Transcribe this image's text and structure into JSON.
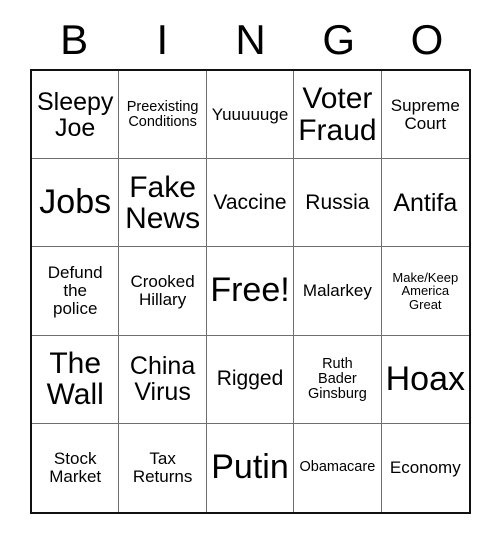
{
  "card": {
    "title": "BINGO Card",
    "header_letters": [
      "B",
      "I",
      "N",
      "G",
      "O"
    ],
    "free_space_label": "Free!",
    "colors": {
      "background": "#ffffff",
      "text": "#000000",
      "outer_border": "#111111",
      "inner_border": "#6e6e6e"
    },
    "grid": {
      "rows": 5,
      "columns": 5,
      "cells": [
        {
          "text": "Sleepy\nJoe",
          "size": "lg",
          "free": false
        },
        {
          "text": "Preexisting\nConditions",
          "size": "xs",
          "free": false
        },
        {
          "text": "Yuuuuuge",
          "size": "sm",
          "free": false
        },
        {
          "text": "Voter\nFraud",
          "size": "xl",
          "free": false
        },
        {
          "text": "Supreme\nCourt",
          "size": "sm",
          "free": false
        },
        {
          "text": "Jobs",
          "size": "xxl",
          "free": false
        },
        {
          "text": "Fake\nNews",
          "size": "xl",
          "free": false
        },
        {
          "text": "Vaccine",
          "size": "md",
          "free": false
        },
        {
          "text": "Russia",
          "size": "md",
          "free": false
        },
        {
          "text": "Antifa",
          "size": "lg",
          "free": false
        },
        {
          "text": "Defund\nthe\npolice",
          "size": "sm",
          "free": false
        },
        {
          "text": "Crooked\nHillary",
          "size": "sm",
          "free": false
        },
        {
          "text": "Free!",
          "size": "xxl",
          "free": true
        },
        {
          "text": "Malarkey",
          "size": "sm",
          "free": false
        },
        {
          "text": "Make/Keep\nAmerica\nGreat",
          "size": "xxs",
          "free": false
        },
        {
          "text": "The\nWall",
          "size": "xl",
          "free": false
        },
        {
          "text": "China\nVirus",
          "size": "lg",
          "free": false
        },
        {
          "text": "Rigged",
          "size": "md",
          "free": false
        },
        {
          "text": "Ruth\nBader\nGinsburg",
          "size": "xs",
          "free": false
        },
        {
          "text": "Hoax",
          "size": "xxl",
          "free": false
        },
        {
          "text": "Stock\nMarket",
          "size": "sm",
          "free": false
        },
        {
          "text": "Tax\nReturns",
          "size": "sm",
          "free": false
        },
        {
          "text": "Putin",
          "size": "xxl",
          "free": false
        },
        {
          "text": "Obamacare",
          "size": "xs",
          "free": false
        },
        {
          "text": "Economy",
          "size": "sm",
          "free": false
        }
      ]
    }
  }
}
